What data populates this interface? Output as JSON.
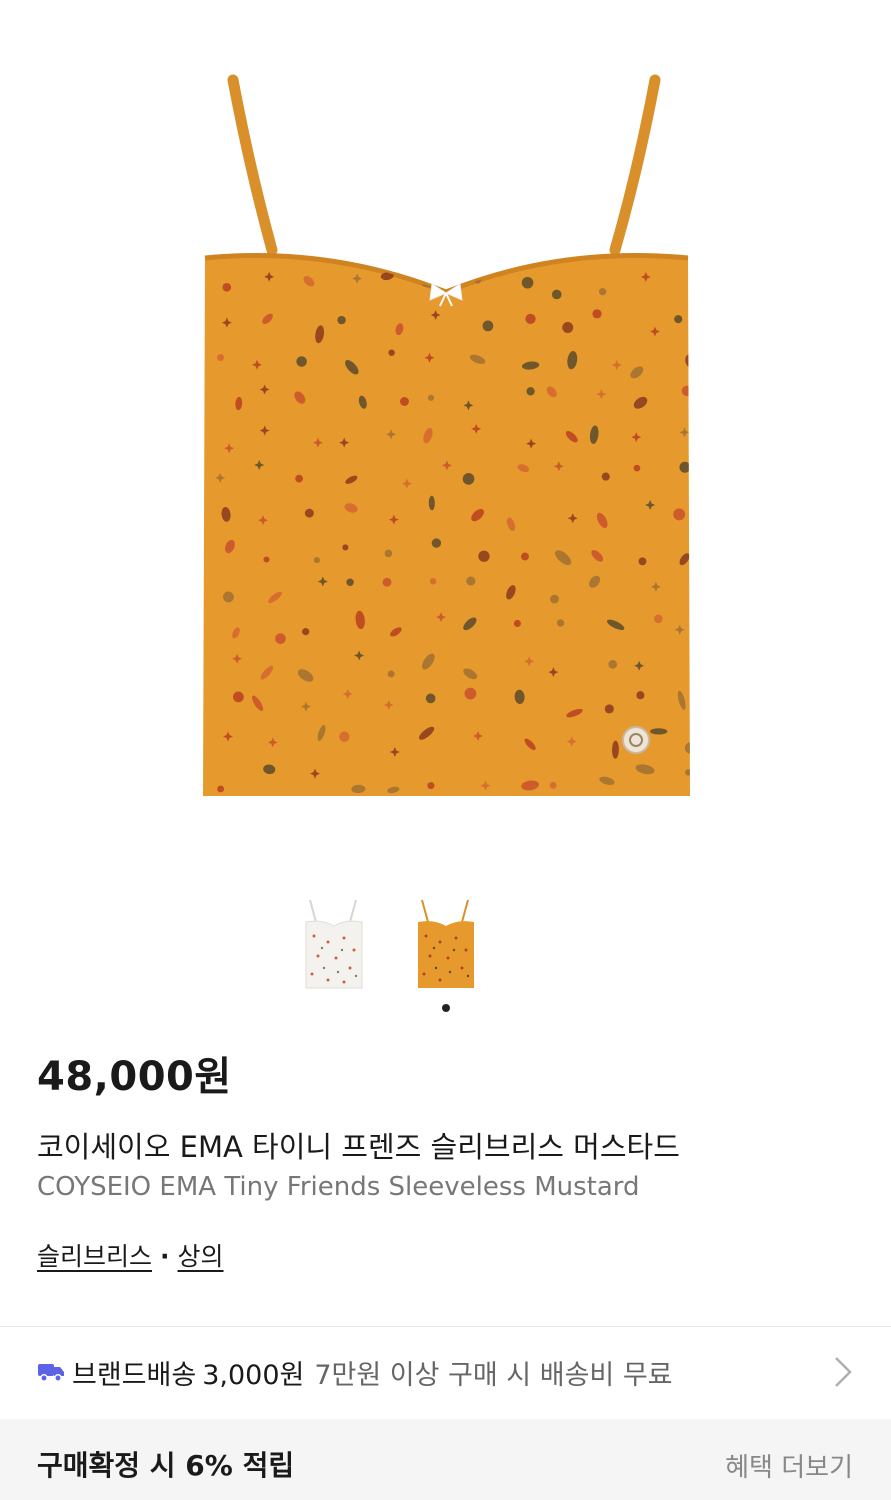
{
  "product": {
    "price": "48,000원",
    "name_ko": "코이세이오 EMA 타이니 프렌즈 슬리브리스 머스타드",
    "name_en": "COYSEIO EMA Tiny Friends Sleeveless Mustard",
    "category_1": "슬리브리스",
    "separator": "·",
    "category_2": "상의",
    "main_color": "#e69a2e",
    "thumbnails": [
      {
        "name": "white-variant",
        "color": "#f4f2ef"
      },
      {
        "name": "mustard-variant",
        "color": "#e69a2e"
      }
    ],
    "selected_thumbnail": 2
  },
  "shipping": {
    "icon": "truck-icon",
    "label": "브랜드배송",
    "fee": "3,000원",
    "note": "7만원 이상 구매 시 배송비 무료",
    "icon_color": "#5b63e6"
  },
  "benefit": {
    "text": "구매확정 시 6% 적립",
    "more": "혜택 더보기"
  }
}
